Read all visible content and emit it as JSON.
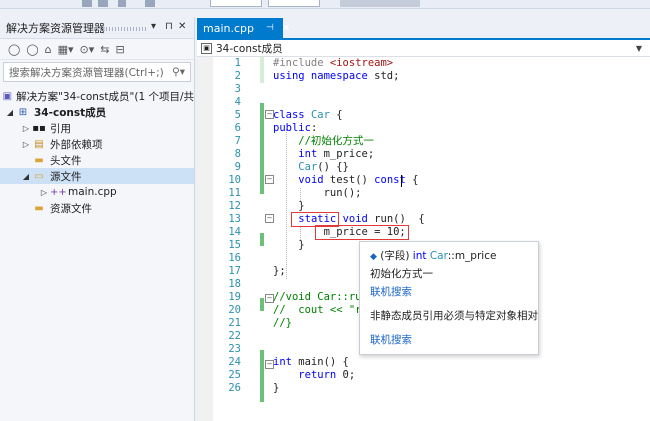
{
  "explorer": {
    "title": "解决方案资源管理器",
    "pin_glyph": "▾ ₽ ✕",
    "search_placeholder": "搜索解决方案资源管理器(Ctrl+;)",
    "items": [
      {
        "label": "解决方案\"34-const成员\"(1 个项目/共"
      },
      {
        "label": "34-const成员"
      },
      {
        "label": "引用"
      },
      {
        "label": "外部依赖项"
      },
      {
        "label": "头文件"
      },
      {
        "label": "源文件"
      },
      {
        "label": "main.cpp"
      },
      {
        "label": "资源文件"
      }
    ]
  },
  "editor": {
    "tab": {
      "label": "main.cpp"
    },
    "scope": "34-const成员",
    "lines": [
      {
        "n": "1",
        "t": "#include <iostream>"
      },
      {
        "n": "2",
        "t": "using namespace std;"
      },
      {
        "n": "3",
        "t": ""
      },
      {
        "n": "4",
        "t": ""
      },
      {
        "n": "5",
        "t": "class Car {"
      },
      {
        "n": "6",
        "t": "public:"
      },
      {
        "n": "7",
        "t": "    //初始化方式一"
      },
      {
        "n": "8",
        "t": "    int m_price;"
      },
      {
        "n": "9",
        "t": "    Car() {}"
      },
      {
        "n": "10",
        "t": "    void test() const {"
      },
      {
        "n": "11",
        "t": "        run();"
      },
      {
        "n": "12",
        "t": "    }"
      },
      {
        "n": "13",
        "t": "    static void run()  {"
      },
      {
        "n": "14",
        "t": "        m_price = 10;"
      },
      {
        "n": "15",
        "t": "    }"
      },
      {
        "n": "16",
        "t": ""
      },
      {
        "n": "17",
        "t": "};"
      },
      {
        "n": "18",
        "t": ""
      },
      {
        "n": "19",
        "t": "//void Car::run"
      },
      {
        "n": "20",
        "t": "//  cout << \"ru"
      },
      {
        "n": "21",
        "t": "//}"
      },
      {
        "n": "22",
        "t": ""
      },
      {
        "n": "23",
        "t": ""
      },
      {
        "n": "24",
        "t": "int main() {"
      },
      {
        "n": "25",
        "t": "    return 0;"
      },
      {
        "n": "26",
        "t": "}"
      }
    ]
  },
  "tooltip": {
    "signature_prefix": "(字段) ",
    "signature_type": "int",
    "signature_class": "Car",
    "signature_rest": "::m_price",
    "comment": "初始化方式一",
    "link1": "联机搜索",
    "error": "非静态成员引用必须与特定对象相对",
    "link2": "联机搜索"
  }
}
